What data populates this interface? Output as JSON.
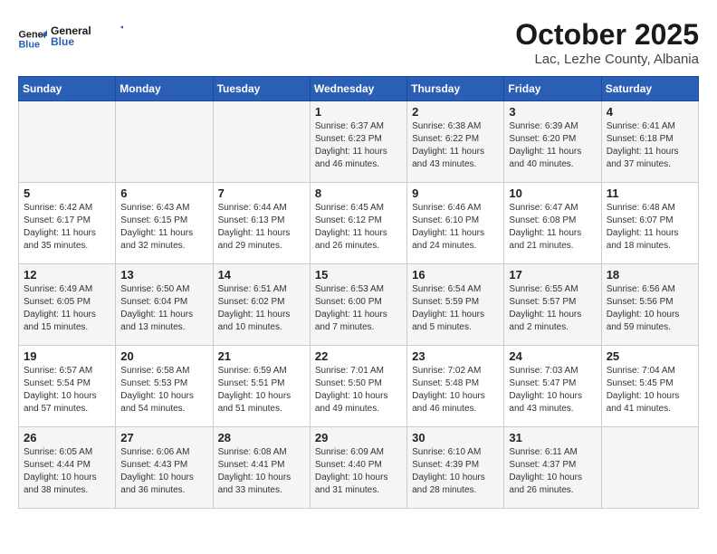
{
  "header": {
    "logo_line1": "General",
    "logo_line2": "Blue",
    "month": "October 2025",
    "location": "Lac, Lezhe County, Albania"
  },
  "weekdays": [
    "Sunday",
    "Monday",
    "Tuesday",
    "Wednesday",
    "Thursday",
    "Friday",
    "Saturday"
  ],
  "weeks": [
    [
      {
        "day": "",
        "info": ""
      },
      {
        "day": "",
        "info": ""
      },
      {
        "day": "",
        "info": ""
      },
      {
        "day": "1",
        "info": "Sunrise: 6:37 AM\nSunset: 6:23 PM\nDaylight: 11 hours and 46 minutes."
      },
      {
        "day": "2",
        "info": "Sunrise: 6:38 AM\nSunset: 6:22 PM\nDaylight: 11 hours and 43 minutes."
      },
      {
        "day": "3",
        "info": "Sunrise: 6:39 AM\nSunset: 6:20 PM\nDaylight: 11 hours and 40 minutes."
      },
      {
        "day": "4",
        "info": "Sunrise: 6:41 AM\nSunset: 6:18 PM\nDaylight: 11 hours and 37 minutes."
      }
    ],
    [
      {
        "day": "5",
        "info": "Sunrise: 6:42 AM\nSunset: 6:17 PM\nDaylight: 11 hours and 35 minutes."
      },
      {
        "day": "6",
        "info": "Sunrise: 6:43 AM\nSunset: 6:15 PM\nDaylight: 11 hours and 32 minutes."
      },
      {
        "day": "7",
        "info": "Sunrise: 6:44 AM\nSunset: 6:13 PM\nDaylight: 11 hours and 29 minutes."
      },
      {
        "day": "8",
        "info": "Sunrise: 6:45 AM\nSunset: 6:12 PM\nDaylight: 11 hours and 26 minutes."
      },
      {
        "day": "9",
        "info": "Sunrise: 6:46 AM\nSunset: 6:10 PM\nDaylight: 11 hours and 24 minutes."
      },
      {
        "day": "10",
        "info": "Sunrise: 6:47 AM\nSunset: 6:08 PM\nDaylight: 11 hours and 21 minutes."
      },
      {
        "day": "11",
        "info": "Sunrise: 6:48 AM\nSunset: 6:07 PM\nDaylight: 11 hours and 18 minutes."
      }
    ],
    [
      {
        "day": "12",
        "info": "Sunrise: 6:49 AM\nSunset: 6:05 PM\nDaylight: 11 hours and 15 minutes."
      },
      {
        "day": "13",
        "info": "Sunrise: 6:50 AM\nSunset: 6:04 PM\nDaylight: 11 hours and 13 minutes."
      },
      {
        "day": "14",
        "info": "Sunrise: 6:51 AM\nSunset: 6:02 PM\nDaylight: 11 hours and 10 minutes."
      },
      {
        "day": "15",
        "info": "Sunrise: 6:53 AM\nSunset: 6:00 PM\nDaylight: 11 hours and 7 minutes."
      },
      {
        "day": "16",
        "info": "Sunrise: 6:54 AM\nSunset: 5:59 PM\nDaylight: 11 hours and 5 minutes."
      },
      {
        "day": "17",
        "info": "Sunrise: 6:55 AM\nSunset: 5:57 PM\nDaylight: 11 hours and 2 minutes."
      },
      {
        "day": "18",
        "info": "Sunrise: 6:56 AM\nSunset: 5:56 PM\nDaylight: 10 hours and 59 minutes."
      }
    ],
    [
      {
        "day": "19",
        "info": "Sunrise: 6:57 AM\nSunset: 5:54 PM\nDaylight: 10 hours and 57 minutes."
      },
      {
        "day": "20",
        "info": "Sunrise: 6:58 AM\nSunset: 5:53 PM\nDaylight: 10 hours and 54 minutes."
      },
      {
        "day": "21",
        "info": "Sunrise: 6:59 AM\nSunset: 5:51 PM\nDaylight: 10 hours and 51 minutes."
      },
      {
        "day": "22",
        "info": "Sunrise: 7:01 AM\nSunset: 5:50 PM\nDaylight: 10 hours and 49 minutes."
      },
      {
        "day": "23",
        "info": "Sunrise: 7:02 AM\nSunset: 5:48 PM\nDaylight: 10 hours and 46 minutes."
      },
      {
        "day": "24",
        "info": "Sunrise: 7:03 AM\nSunset: 5:47 PM\nDaylight: 10 hours and 43 minutes."
      },
      {
        "day": "25",
        "info": "Sunrise: 7:04 AM\nSunset: 5:45 PM\nDaylight: 10 hours and 41 minutes."
      }
    ],
    [
      {
        "day": "26",
        "info": "Sunrise: 6:05 AM\nSunset: 4:44 PM\nDaylight: 10 hours and 38 minutes."
      },
      {
        "day": "27",
        "info": "Sunrise: 6:06 AM\nSunset: 4:43 PM\nDaylight: 10 hours and 36 minutes."
      },
      {
        "day": "28",
        "info": "Sunrise: 6:08 AM\nSunset: 4:41 PM\nDaylight: 10 hours and 33 minutes."
      },
      {
        "day": "29",
        "info": "Sunrise: 6:09 AM\nSunset: 4:40 PM\nDaylight: 10 hours and 31 minutes."
      },
      {
        "day": "30",
        "info": "Sunrise: 6:10 AM\nSunset: 4:39 PM\nDaylight: 10 hours and 28 minutes."
      },
      {
        "day": "31",
        "info": "Sunrise: 6:11 AM\nSunset: 4:37 PM\nDaylight: 10 hours and 26 minutes."
      },
      {
        "day": "",
        "info": ""
      }
    ]
  ]
}
